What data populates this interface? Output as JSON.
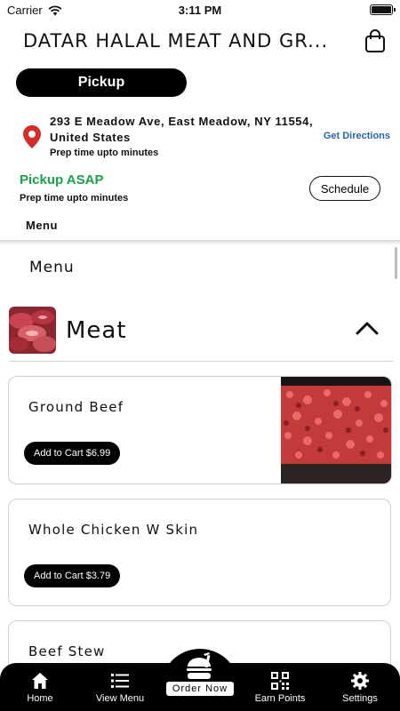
{
  "status_bar": {
    "carrier": "Carrier",
    "time": "3:11 PM"
  },
  "header": {
    "store_title": "DATAR HALAL MEAT AND GR..."
  },
  "order_mode": {
    "pickup_label": "Pickup"
  },
  "location": {
    "address": "293 E Meadow Ave, East Meadow, NY 11554, United States",
    "prep_time": "Prep time upto minutes",
    "directions_label": "Get Directions"
  },
  "pickup": {
    "title": "Pickup ASAP",
    "prep_time": "Prep time upto minutes",
    "schedule_label": "Schedule"
  },
  "tabs": {
    "menu_label": "Menu"
  },
  "menu": {
    "heading": "Menu",
    "category": {
      "name": "Meat"
    },
    "items": [
      {
        "name": "Ground Beef",
        "button": "Add to Cart $6.99"
      },
      {
        "name": "Whole Chicken W Skin",
        "button": "Add to Cart $3.79"
      },
      {
        "name": "Beef Stew",
        "button": ""
      }
    ]
  },
  "bottom_nav": {
    "home": "Home",
    "view_menu": "View Menu",
    "order_now": "Order Now",
    "earn_points": "Earn Points",
    "settings": "Settings"
  },
  "colors": {
    "accent_green": "#19a24a",
    "link_blue": "#2767a8",
    "pin_red": "#d62b2b",
    "nav_background": "#000000"
  }
}
